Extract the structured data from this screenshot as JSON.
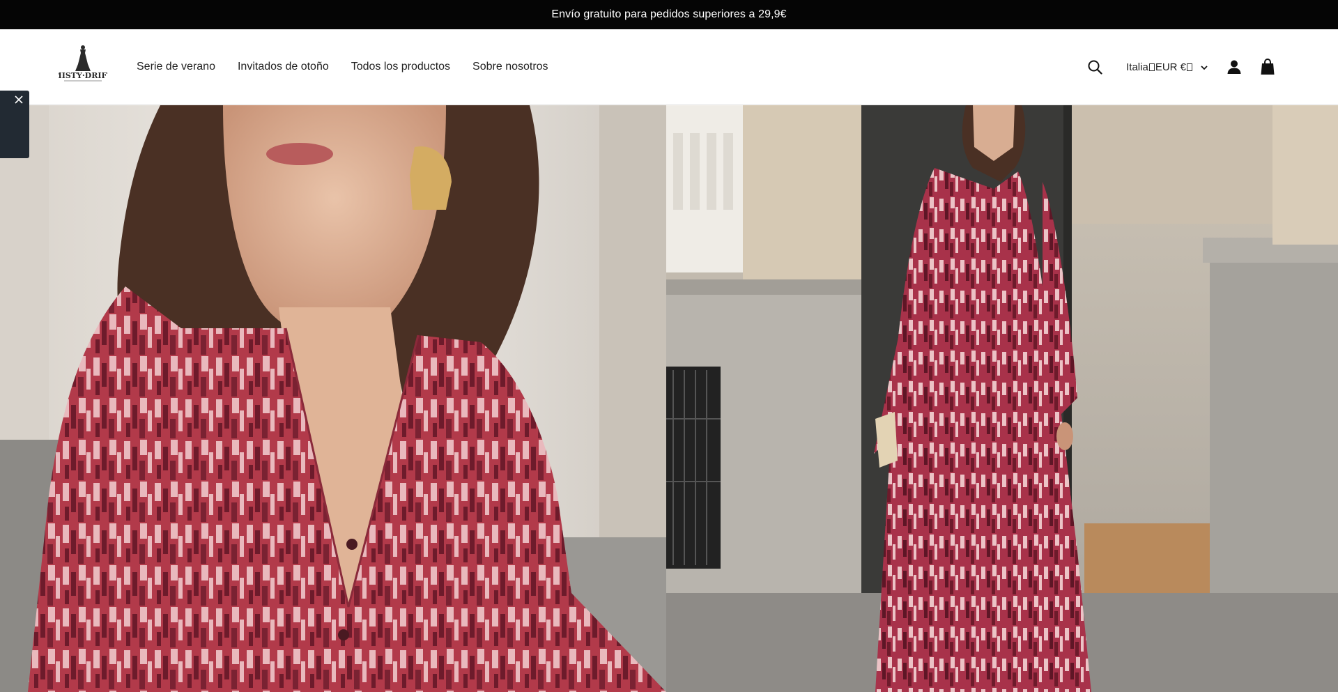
{
  "announcement": {
    "text": "Envío gratuito para pedidos superiores a 29,9€"
  },
  "header": {
    "logo_alt": "MISTY DRIFT",
    "nav": [
      {
        "label": "Serie de verano"
      },
      {
        "label": "Invitados de otoño"
      },
      {
        "label": "Todos los productos"
      },
      {
        "label": "Sobre nosotros"
      }
    ],
    "locale": {
      "country": "Italia",
      "currency": "EUR €"
    },
    "icons": {
      "search": "search-icon",
      "account": "user-icon",
      "cart": "bag-icon",
      "locale_dropdown": "chevron-down-icon"
    }
  },
  "hero": {
    "left_image": "model-closeup-red-print-dress",
    "right_image": "model-full-length-red-print-dress"
  },
  "side_tab": {
    "close_icon": "close-icon"
  },
  "colors": {
    "announcement_bg": "#050505",
    "dress_red": "#b23a4a",
    "dress_dark": "#6d1b2b",
    "dress_pink": "#e9b9bd"
  }
}
